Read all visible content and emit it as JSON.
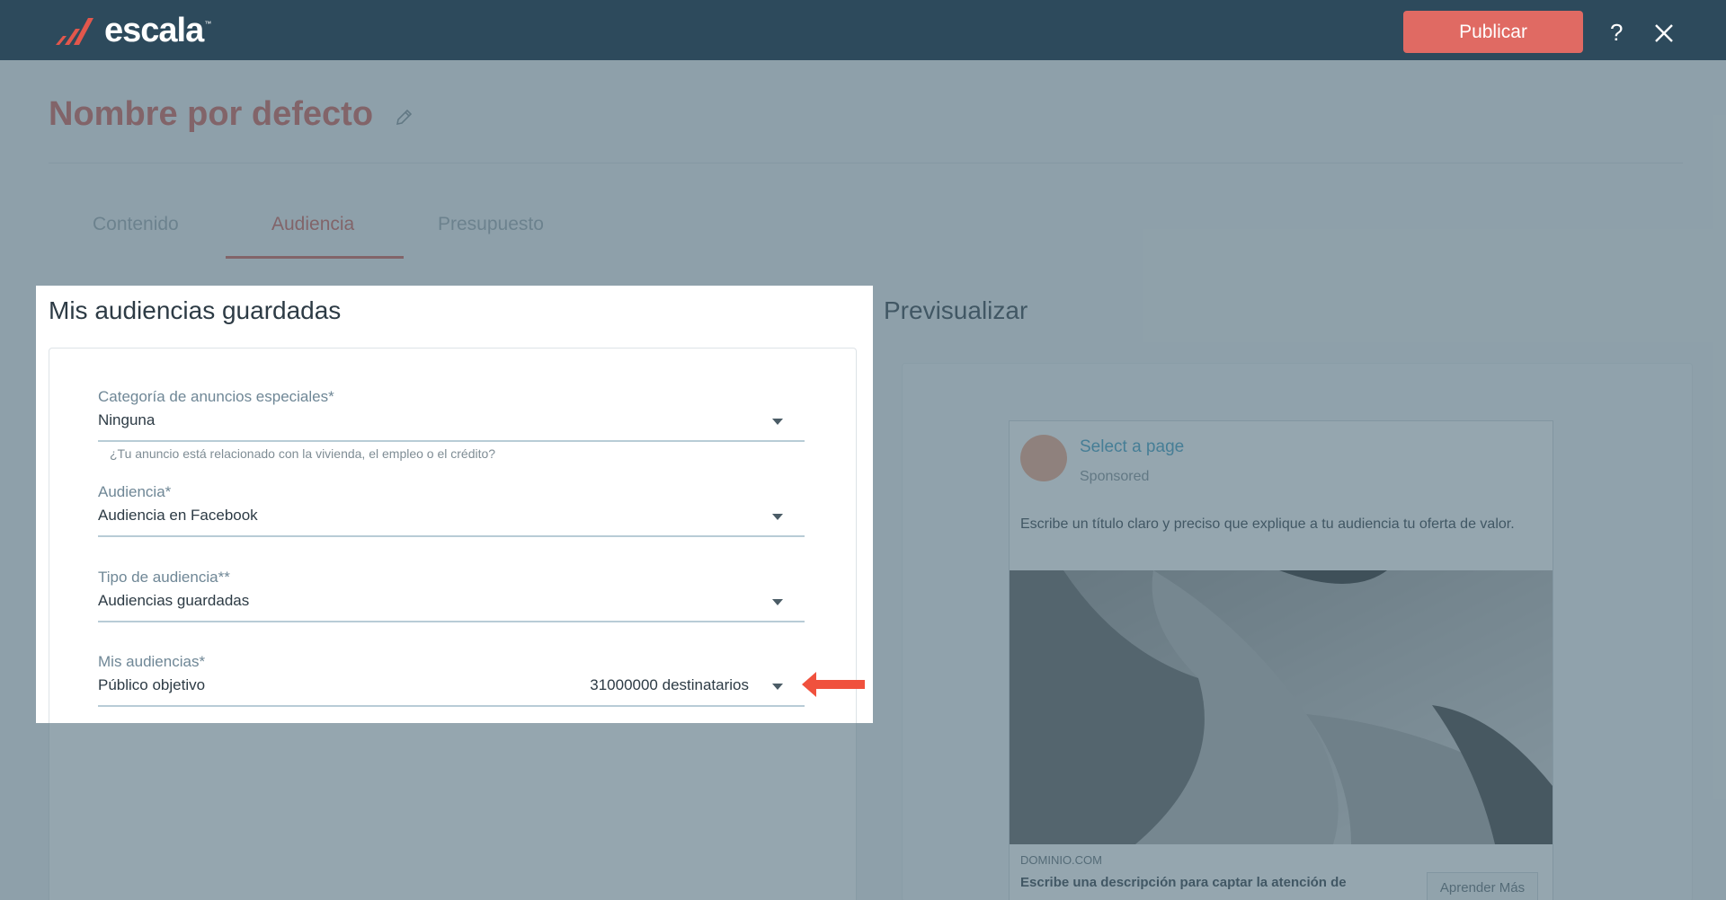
{
  "app": {
    "brand": "escala",
    "publish_label": "Publicar",
    "help_label": "?"
  },
  "page": {
    "title": "Nombre por defecto"
  },
  "tabs": [
    {
      "label": "Contenido",
      "active": false
    },
    {
      "label": "Audiencia",
      "active": true
    },
    {
      "label": "Presupuesto",
      "active": false
    }
  ],
  "audiences": {
    "section_title": "Mis audiencias guardadas",
    "fields": [
      {
        "label": "Categoría de anuncios especiales*",
        "value": "Ninguna",
        "hint": "¿Tu anuncio está relacionado con la vivienda, el empleo o el crédito?"
      },
      {
        "label": "Audiencia*",
        "value": "Audiencia en Facebook"
      },
      {
        "label": "Tipo de audiencia**",
        "value": "Audiencias guardadas"
      },
      {
        "label": "Mis audiencias*",
        "value": "Público objetivo",
        "recipients": "31000000 destinatarios"
      }
    ]
  },
  "preview": {
    "title": "Previsualizar",
    "page_name": "Select a page",
    "sponsored": "Sponsored",
    "headline": "Escribe un título claro y preciso que explique a tu audiencia tu oferta de valor.",
    "domain": "DOMINIO.COM",
    "description": "Escribe una descripción para captar la atención de",
    "cta": "Aprender Más"
  },
  "colors": {
    "topbar": "#2d4a5c",
    "accent": "#e06a63",
    "title": "#cf5a52",
    "overlay": "#4f6b79",
    "arrow": "#f0513d",
    "link": "#3b9cc0"
  }
}
